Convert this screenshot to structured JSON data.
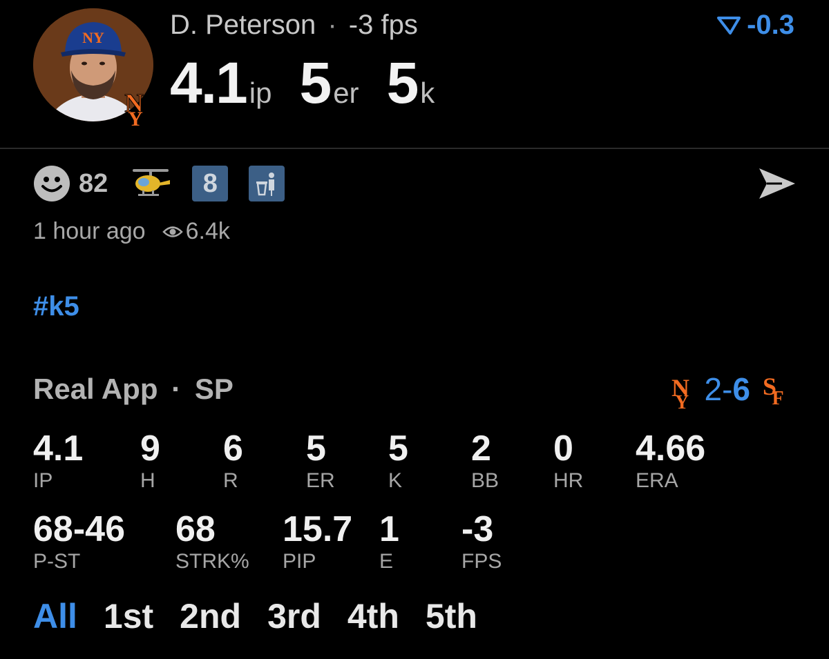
{
  "header": {
    "player_name": "D. Peterson",
    "separator": "·",
    "fps_text": "-3 fps",
    "delta": "-0.3",
    "line": [
      {
        "value": "4.1",
        "unit": "ip"
      },
      {
        "value": "5",
        "unit": "er"
      },
      {
        "value": "5",
        "unit": "k"
      }
    ]
  },
  "reactions": {
    "smiley_count": "82",
    "badge_number": "8",
    "icons": [
      "smiley-icon",
      "helicopter-icon",
      "number-badge",
      "trash-icon"
    ]
  },
  "meta": {
    "time_ago": "1 hour ago",
    "views": "6.4k"
  },
  "hashtag": "#k5",
  "game": {
    "app_name": "Real App",
    "separator": "·",
    "position": "SP",
    "score_left": "2",
    "score_dash": "-",
    "score_right": "6"
  },
  "stats_row1": [
    {
      "value": "4.1",
      "label": "IP"
    },
    {
      "value": "9",
      "label": "H"
    },
    {
      "value": "6",
      "label": "R"
    },
    {
      "value": "5",
      "label": "ER"
    },
    {
      "value": "5",
      "label": "K"
    },
    {
      "value": "2",
      "label": "BB"
    },
    {
      "value": "0",
      "label": "HR"
    },
    {
      "value": "4.66",
      "label": "ERA"
    }
  ],
  "stats_row2": [
    {
      "value": "68-46",
      "label": "P-ST"
    },
    {
      "value": "68",
      "label": "STRK%"
    },
    {
      "value": "15.7",
      "label": "PIP"
    },
    {
      "value": "1",
      "label": "E"
    },
    {
      "value": "-3",
      "label": "FPS"
    }
  ],
  "innings_tabs": [
    "All",
    "1st",
    "2nd",
    "3rd",
    "4th",
    "5th"
  ],
  "active_tab": "All",
  "colors": {
    "accent": "#3e8ee8",
    "mets_orange": "#f26b21",
    "background": "#000000"
  }
}
